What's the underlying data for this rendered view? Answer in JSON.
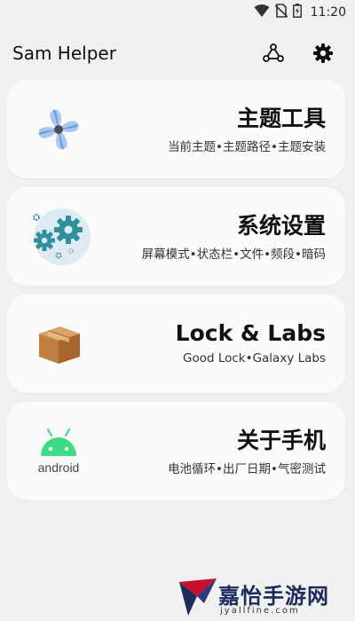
{
  "status_bar": {
    "time": "11:20",
    "icons": [
      "wifi-icon",
      "no-sim-icon",
      "battery-charging-icon"
    ]
  },
  "app_bar": {
    "title": "Sam Helper",
    "actions": [
      "share-nodes-icon",
      "gear-icon"
    ]
  },
  "cards": [
    {
      "title": "主题工具",
      "subtitle": "当前主题•主题路径•主题安装",
      "icon": "pinwheel-icon"
    },
    {
      "title": "系统设置",
      "subtitle": "屏幕模式•状态栏•文件•频段•暗码",
      "icon": "gears-icon"
    },
    {
      "title": "Lock & Labs",
      "subtitle": "Good Lock•Galaxy Labs",
      "icon": "package-box-icon"
    },
    {
      "title": "关于手机",
      "subtitle": "电池循环•出厂日期•气密测试",
      "icon": "android-icon",
      "icon_text": "android"
    }
  ],
  "watermark": {
    "text": "嘉怡手游网",
    "url": "jyallfine.com"
  },
  "colors": {
    "background": "#f0f0f0",
    "card": "#fafafa",
    "android_green": "#3ddc84",
    "gear_teal": "#2f8f9d"
  }
}
